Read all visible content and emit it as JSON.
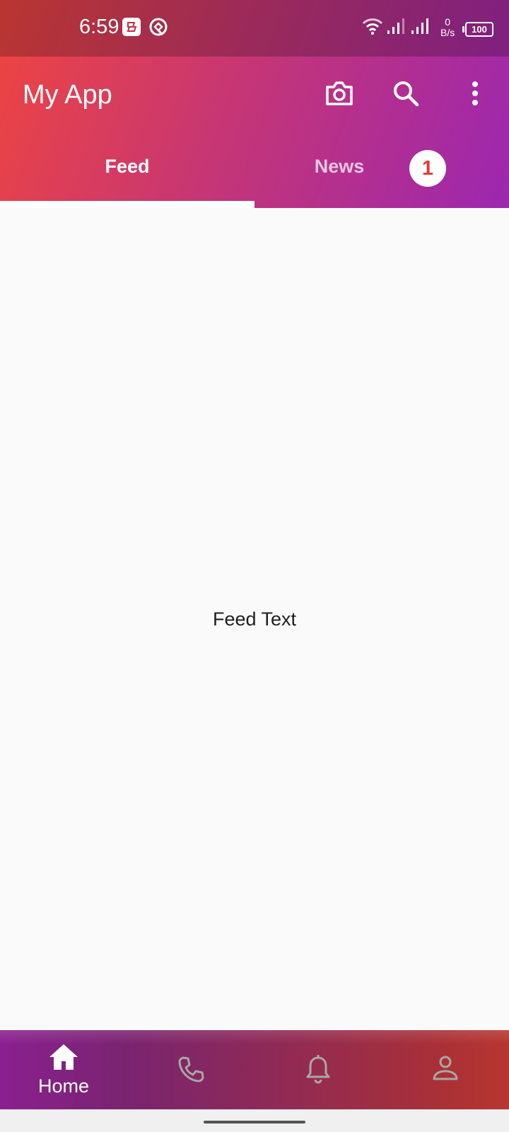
{
  "status_bar": {
    "time": "6:59",
    "icons": [
      "notes-app-icon",
      "sync-app-icon",
      "wifi-icon",
      "signal-icon",
      "signal-icon"
    ],
    "net_rate_value": "0",
    "net_rate_unit": "B/s",
    "battery": "100"
  },
  "app_bar": {
    "title": "My App",
    "actions": [
      "camera-icon",
      "search-icon",
      "more-vert-icon"
    ]
  },
  "tabs": [
    {
      "label": "Feed",
      "selected": true
    },
    {
      "label": "News",
      "selected": false,
      "badge": "1"
    }
  ],
  "content": {
    "text": "Feed Text"
  },
  "bottom_nav": {
    "items": [
      {
        "icon": "home-icon",
        "label": "Home",
        "selected": true
      },
      {
        "icon": "phone-icon",
        "selected": false
      },
      {
        "icon": "bell-icon",
        "selected": false
      },
      {
        "icon": "person-icon",
        "selected": false
      }
    ]
  },
  "colors": {
    "gradient_start": "#ef4540",
    "gradient_end": "#9c27b0",
    "badge_text": "#e53935",
    "content_bg": "#fafafa"
  }
}
